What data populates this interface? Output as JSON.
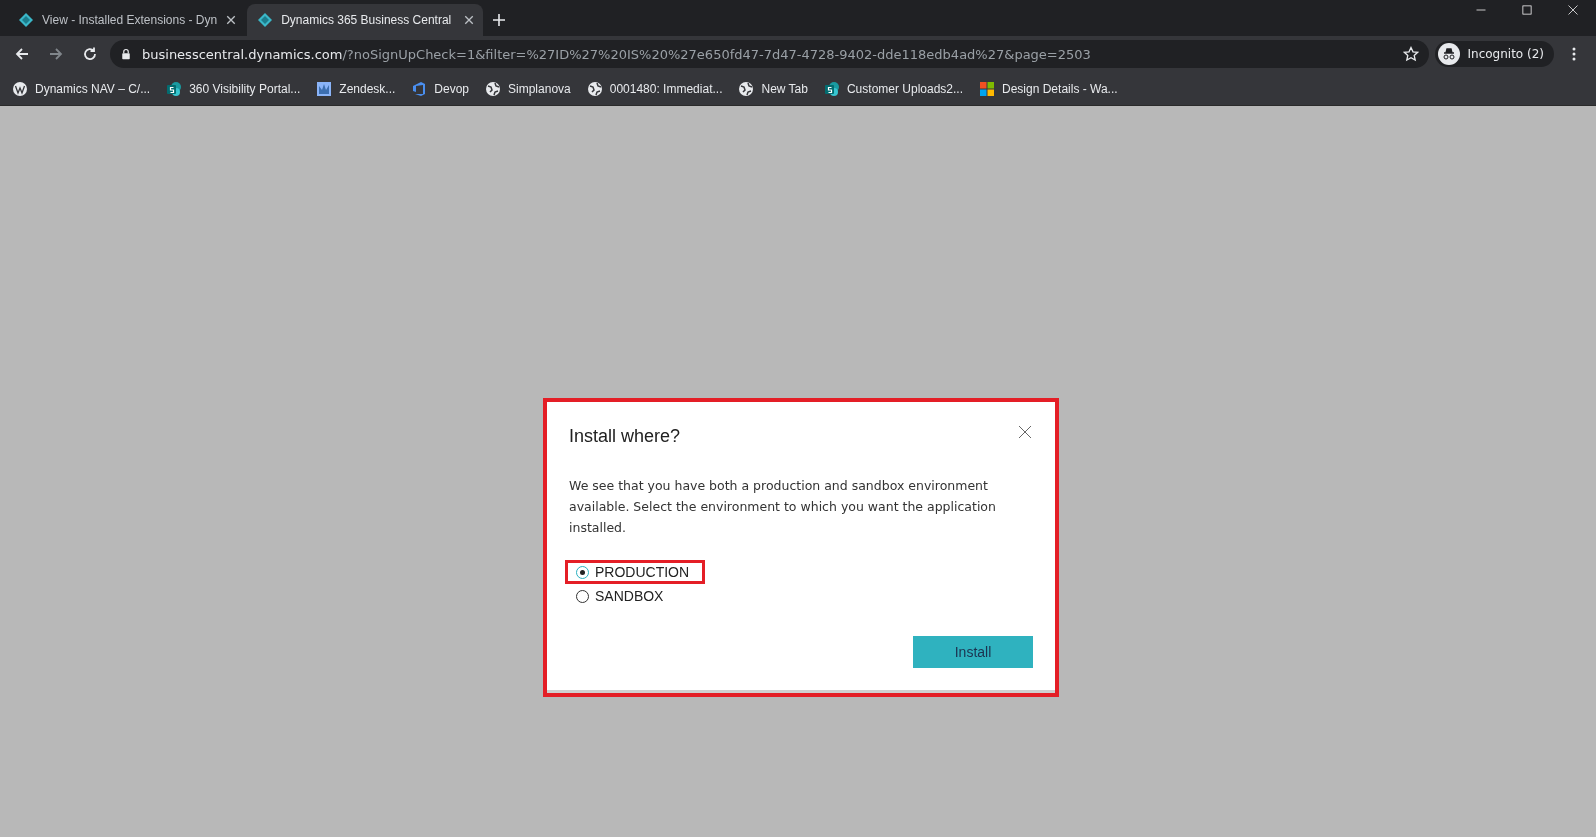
{
  "tabs": [
    {
      "title": "View - Installed Extensions - Dyn",
      "selected": false
    },
    {
      "title": "Dynamics 365 Business Central",
      "selected": true
    }
  ],
  "address_bar": {
    "host": "businesscentral.dynamics.com",
    "path": "/?noSignUpCheck=1&filter=%27ID%27%20IS%20%27e650fd47-7d47-4728-9402-dde118edb4ad%27&page=2503"
  },
  "profile": {
    "label": "Incognito (2)"
  },
  "bookmarks": [
    {
      "label": "Dynamics NAV – C/...",
      "kind": "wordpress"
    },
    {
      "label": "360 Visibility Portal...",
      "kind": "sharepoint"
    },
    {
      "label": "Zendesk...",
      "kind": "picture"
    },
    {
      "label": "Devop",
      "kind": "devops"
    },
    {
      "label": "Simplanova",
      "kind": "globe"
    },
    {
      "label": "0001480: Immediat...",
      "kind": "globe"
    },
    {
      "label": "New Tab",
      "kind": "globe"
    },
    {
      "label": "Customer Uploads2...",
      "kind": "sharepoint"
    },
    {
      "label": "Design Details - Wa...",
      "kind": "windows"
    }
  ],
  "dialog": {
    "title": "Install where?",
    "highlighted": true,
    "message": "We see that you have both a production and sandbox environment available. Select the environment to which you want the application installed.",
    "options": [
      {
        "label": "PRODUCTION",
        "selected": true,
        "highlighted": true
      },
      {
        "label": "SANDBOX",
        "selected": false,
        "highlighted": false
      }
    ],
    "button": "Install"
  }
}
